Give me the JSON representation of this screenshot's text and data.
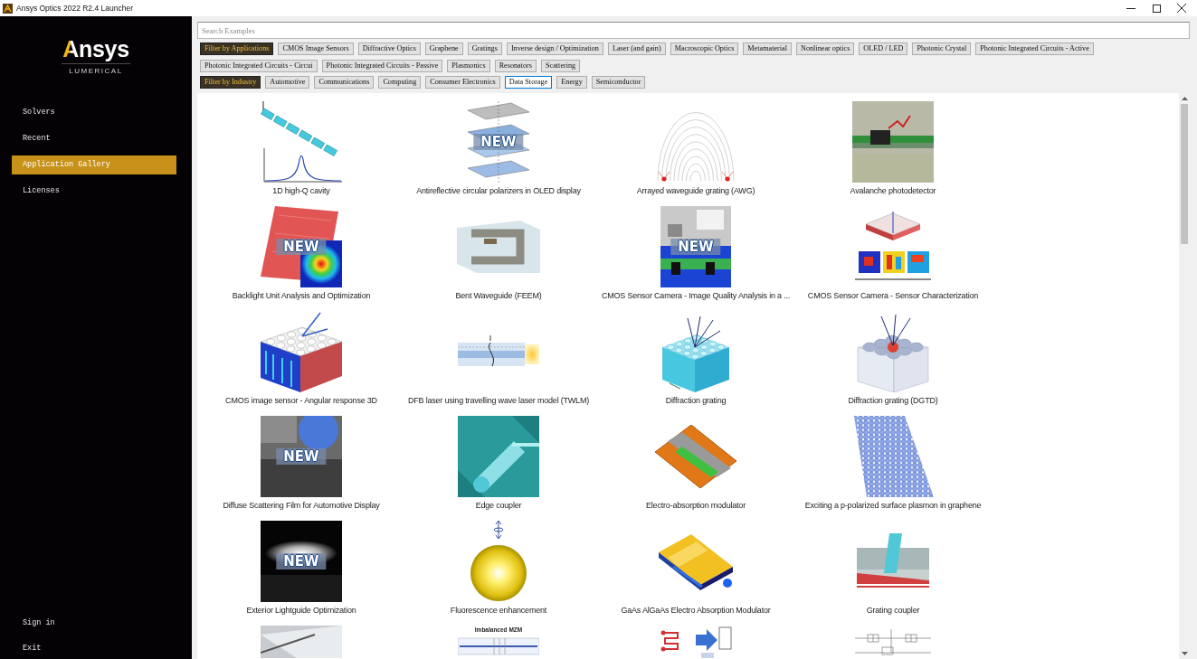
{
  "window": {
    "title": "Ansys Optics 2022 R2.4 Launcher"
  },
  "sidebar": {
    "logo": {
      "wordmark": "Ansys",
      "subtitle": "LUMERICAL"
    },
    "items": [
      {
        "label": "Solvers",
        "selected": false
      },
      {
        "label": "Recent",
        "selected": false
      },
      {
        "label": "Application Gallery",
        "selected": true
      },
      {
        "label": "Licenses",
        "selected": false
      }
    ],
    "footer_items": [
      "Sign in",
      "Exit"
    ]
  },
  "search": {
    "placeholder": "Search Examples"
  },
  "filter_groups": [
    {
      "label": "Filter by Applications",
      "options": [
        {
          "label": "CMOS Image Sensors",
          "selected": false
        },
        {
          "label": "Diffractive Optics",
          "selected": false
        },
        {
          "label": "Graphene",
          "selected": false
        },
        {
          "label": "Gratings",
          "selected": false
        },
        {
          "label": "Inverse design / Optimization",
          "selected": false
        },
        {
          "label": "Laser (and gain)",
          "selected": false
        },
        {
          "label": "Macroscopic Optics",
          "selected": false
        },
        {
          "label": "Metamaterial",
          "selected": false
        },
        {
          "label": "Nonlinear optics",
          "selected": false
        },
        {
          "label": "OLED / LED",
          "selected": false
        },
        {
          "label": "Photonic Crystal",
          "selected": false
        },
        {
          "label": "Photonic Integrated Circuits - Active",
          "selected": false
        },
        {
          "label": "Photonic Integrated Circuits - Circui",
          "selected": false
        },
        {
          "label": "Photonic Integrated Circuits - Passive",
          "selected": false
        },
        {
          "label": "Plasmonics",
          "selected": false
        },
        {
          "label": "Resonators",
          "selected": false
        },
        {
          "label": "Scattering",
          "selected": false
        }
      ]
    },
    {
      "label": "Filter by Industry",
      "options": [
        {
          "label": "Automotive",
          "selected": false
        },
        {
          "label": "Communications",
          "selected": false
        },
        {
          "label": "Computing",
          "selected": false
        },
        {
          "label": "Consumer Electronics",
          "selected": false
        },
        {
          "label": "Data Storage",
          "selected": true
        },
        {
          "label": "Energy",
          "selected": false
        },
        {
          "label": "Semiconductor",
          "selected": false
        }
      ]
    }
  ],
  "gallery": {
    "items": [
      {
        "kind": "example",
        "title": "1D high-Q cavity"
      },
      {
        "kind": "example",
        "title": "Antireflective circular polarizers in OLED display",
        "badge": "NEW"
      },
      {
        "kind": "example",
        "title": "Arrayed waveguide grating (AWG)"
      },
      {
        "kind": "example",
        "title": "Avalanche photodetector"
      },
      {
        "kind": "example",
        "title": "Backlight Unit Analysis and Optimization",
        "badge": "NEW"
      },
      {
        "kind": "example",
        "title": "Bent Waveguide (FEEM)"
      },
      {
        "kind": "example",
        "title": "CMOS Sensor Camera - Image Quality Analysis in a ...",
        "badge": "NEW"
      },
      {
        "kind": "example",
        "title": "CMOS Sensor Camera - Sensor Characterization"
      },
      {
        "kind": "example",
        "title": "CMOS image sensor - Angular response 3D"
      },
      {
        "kind": "example",
        "title": "DFB laser using travelling wave laser model (TWLM)"
      },
      {
        "kind": "example",
        "title": "Diffraction grating"
      },
      {
        "kind": "example",
        "title": "Diffraction grating (DGTD)"
      },
      {
        "kind": "example",
        "title": "Diffuse Scattering Film for Automotive Display",
        "badge": "NEW"
      },
      {
        "kind": "example",
        "title": "Edge coupler"
      },
      {
        "kind": "example",
        "title": "Electro-absorption modulator"
      },
      {
        "kind": "example",
        "title": "Exciting a p-polarized surface plasmon in graphene"
      },
      {
        "kind": "example",
        "title": "Exterior Lightguide Optimization",
        "badge": "NEW"
      },
      {
        "kind": "example",
        "title": "Fluorescence enhancement"
      },
      {
        "kind": "example",
        "title": "GaAs AlGaAs Electro Absorption Modulator"
      },
      {
        "kind": "example",
        "title": "Grating coupler"
      },
      {
        "kind": "cut_off"
      },
      {
        "kind": "cut_off",
        "image_title": "Imbalanced MZM"
      },
      {
        "kind": "cut_off"
      },
      {
        "kind": "cut_off"
      }
    ]
  }
}
